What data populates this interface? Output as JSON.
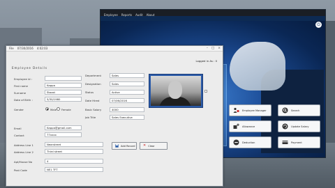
{
  "back_window": {
    "menu": [
      "Employee",
      "Reports",
      "Audit",
      "About"
    ],
    "buttons": [
      {
        "label": "Employee Manager",
        "icon": "users-icon"
      },
      {
        "label": "Search",
        "icon": "search-icon"
      },
      {
        "label": "Allowance",
        "icon": "allowance-icon"
      },
      {
        "label": "Update Salary",
        "icon": "refresh-icon"
      },
      {
        "label": "Deduction",
        "icon": "deduction-icon"
      },
      {
        "label": "Payment",
        "icon": "payment-icon"
      }
    ]
  },
  "front_window": {
    "title_file": "File",
    "title_date": "07/30/2016",
    "title_time": "4:02:03",
    "logged_in": "Logged in As : 0",
    "section": "Employee Details",
    "labels": {
      "employee_id": "Employee id :",
      "first_name": "First name",
      "surname": "Surname",
      "dob": "Date of Birth :",
      "gender": "Gender",
      "male": "Male",
      "female": "Female",
      "department": "Department",
      "designation": "Designation",
      "status": "Status",
      "date_hired": "Date Hired",
      "basic_salary": "Basic Salary",
      "job_title": "Job Title",
      "email": "Email",
      "contact": "Contact",
      "address1": "Address Line 1",
      "address2": "Address Line 2",
      "apt": "Apt/House No",
      "postcode": "Post Code"
    },
    "values": {
      "employee_id": "",
      "first_name": "Kappa",
      "surname": "Stoost",
      "dob": "5/30/1980",
      "department": "Sales",
      "designation": "Sales",
      "status": "Active",
      "date_hired": "07/06/2016",
      "basic_salary": "4000",
      "job_title": "Sales Executive",
      "email": "Kappa@gmail.com",
      "contact": "77xxxx",
      "address1": "Nearstreet",
      "address2": "Third street",
      "apt": "4",
      "postcode": "NE1 TFT"
    },
    "gender_selected": "Male",
    "add_button": "Add Record",
    "clear_button": "Clear"
  }
}
